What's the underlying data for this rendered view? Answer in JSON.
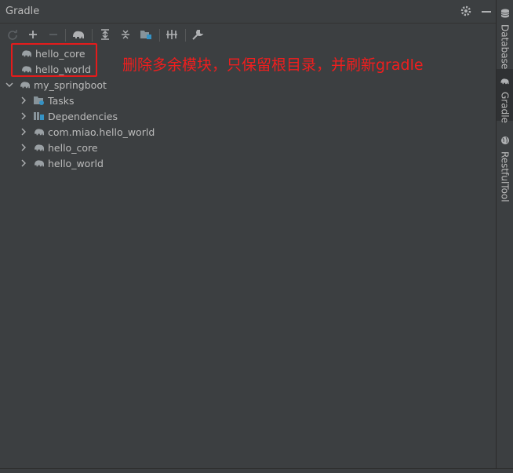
{
  "panel": {
    "title": "Gradle"
  },
  "tree": {
    "items": [
      {
        "label": "hello_core",
        "expandable": false
      },
      {
        "label": "hello_world",
        "expandable": false
      },
      {
        "label": "my_springboot",
        "expandable": true,
        "expanded": true
      },
      {
        "label": "Tasks",
        "expandable": true,
        "expanded": false
      },
      {
        "label": "Dependencies",
        "expandable": true,
        "expanded": false
      },
      {
        "label": "com.miao.hello_world",
        "expandable": true,
        "expanded": false
      },
      {
        "label": "hello_core",
        "expandable": true,
        "expanded": false
      },
      {
        "label": "hello_world",
        "expandable": true,
        "expanded": false
      }
    ]
  },
  "annotation": {
    "text": "删除多余模块，只保留根目录，并刷新gradle",
    "color": "#f01e1e"
  },
  "right_tabs": [
    {
      "label": "Database",
      "icon": "database-icon"
    },
    {
      "label": "Gradle",
      "icon": "elephant-icon",
      "active": true
    },
    {
      "label": "RestfulTool",
      "icon": "globe-icon"
    }
  ],
  "colors": {
    "background": "#3c3f41",
    "text": "#bbbbbb",
    "highlight": "#e51b1b"
  }
}
